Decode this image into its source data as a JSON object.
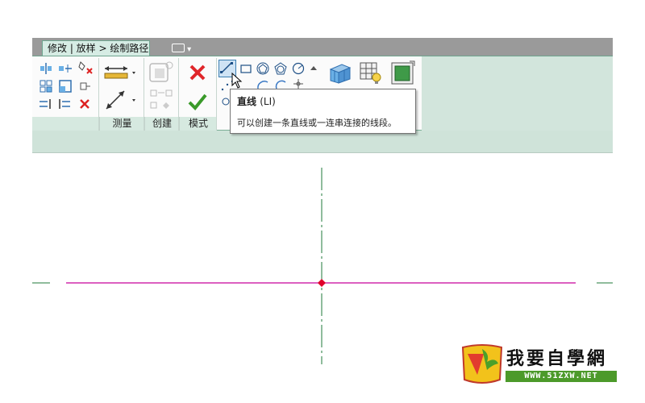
{
  "ribbon": {
    "context_tab": {
      "label": "修改 | 放样 > 绘制路径"
    },
    "panels": {
      "measure": "测量",
      "create": "创建",
      "mode": "模式"
    }
  },
  "tooltip": {
    "title": "直线",
    "shortcut": "(LI)",
    "description": "可以创建一条直线或一连串连接的线段。"
  },
  "canvas": {
    "colors": {
      "horizontal_reference": "#c8009a",
      "vertical_reference": "#1f7a3a",
      "center_point": "#e0002a"
    }
  },
  "watermark": {
    "title": "我要自學網",
    "url": "WWW.51ZXW.NET"
  },
  "colors": {
    "ribbon_accent": "#6fa58f",
    "panel_label_bg": "#d6e9e0",
    "options_bar_bg": "#cfe3d9",
    "title_bar_bg": "#9a9a9a"
  }
}
